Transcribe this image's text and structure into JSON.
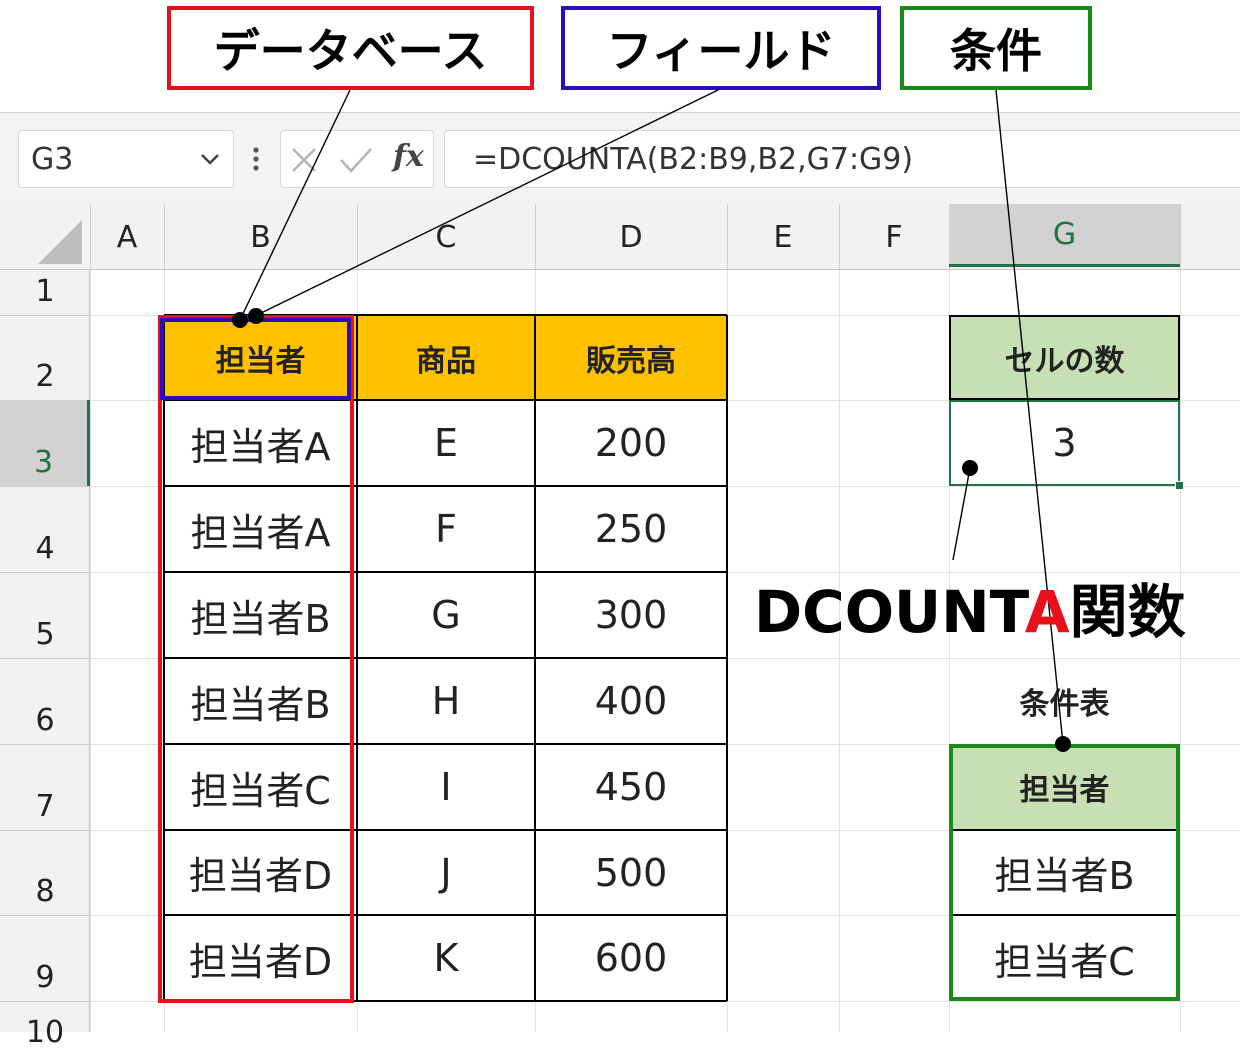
{
  "callouts": {
    "database": "データベース",
    "field": "フィールド",
    "criteria": "条件"
  },
  "formula_bar": {
    "name_box": "G3",
    "cancel_icon": "×",
    "enter_icon": "✓",
    "fx_label": "fx",
    "formula": "=DCOUNTA(B2:B9,B2,G7:G9)"
  },
  "columns": [
    "A",
    "B",
    "C",
    "D",
    "E",
    "F",
    "G"
  ],
  "rows": [
    "1",
    "2",
    "3",
    "4",
    "5",
    "6",
    "7",
    "8",
    "9",
    "10"
  ],
  "table": {
    "headers": [
      "担当者",
      "商品",
      "販売高"
    ],
    "rows": [
      [
        "担当者A",
        "E",
        "200"
      ],
      [
        "担当者A",
        "F",
        "250"
      ],
      [
        "担当者B",
        "G",
        "300"
      ],
      [
        "担当者B",
        "H",
        "400"
      ],
      [
        "担当者C",
        "I",
        "450"
      ],
      [
        "担当者D",
        "J",
        "500"
      ],
      [
        "担当者D",
        "K",
        "600"
      ]
    ]
  },
  "result": {
    "header": "セルの数",
    "value": "3"
  },
  "function_label": {
    "prefix": "DCOUNT",
    "highlight": "A",
    "suffix": "関数"
  },
  "criteria_table": {
    "title": "条件表",
    "header": "担当者",
    "values": [
      "担当者B",
      "担当者C"
    ]
  },
  "colors": {
    "database_red": "#e8101a",
    "field_blue": "#2a0bc0",
    "criteria_green": "#1b8a1b",
    "header_orange": "#ffc000",
    "header_green": "#c6e0b4",
    "excel_green": "#217346"
  }
}
